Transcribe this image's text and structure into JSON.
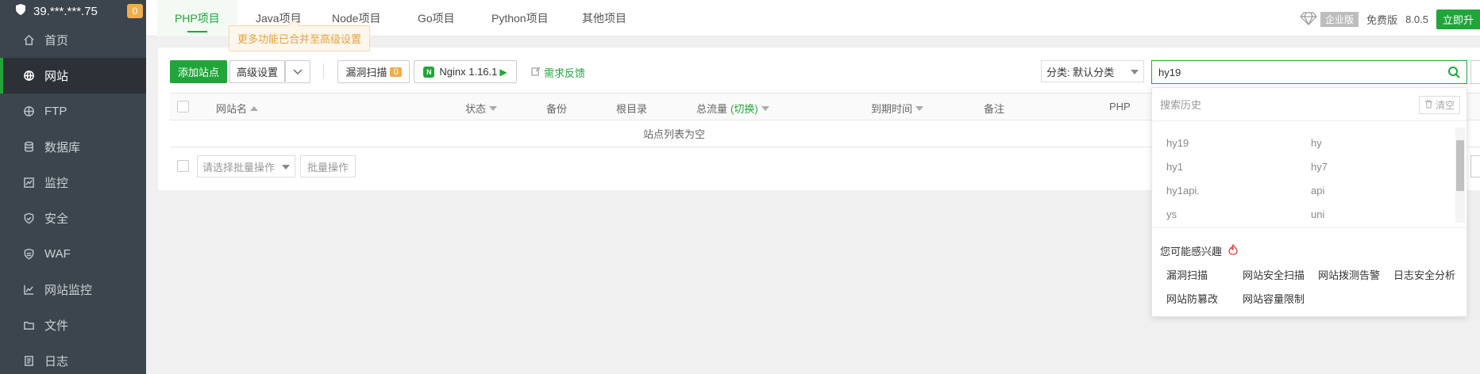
{
  "sidebar": {
    "server": "39.***.***.75",
    "badge": "0",
    "items": [
      {
        "label": "首页",
        "icon": "home-icon"
      },
      {
        "label": "网站",
        "icon": "globe-icon"
      },
      {
        "label": "FTP",
        "icon": "ftp-icon"
      },
      {
        "label": "数据库",
        "icon": "database-icon"
      },
      {
        "label": "监控",
        "icon": "monitor-icon"
      },
      {
        "label": "安全",
        "icon": "shield-icon"
      },
      {
        "label": "WAF",
        "icon": "waf-icon"
      },
      {
        "label": "网站监控",
        "icon": "chart-icon"
      },
      {
        "label": "文件",
        "icon": "folder-icon"
      },
      {
        "label": "日志",
        "icon": "log-icon"
      }
    ]
  },
  "tabs": [
    "PHP项目",
    "Java项目",
    "Node项目",
    "Go项目",
    "Python项目",
    "其他项目"
  ],
  "top_right": {
    "enterprise": "企业版",
    "free": "免费版",
    "version": "8.0.5",
    "buy": "立即升"
  },
  "tooltip": "更多功能已合并至高级设置",
  "toolbar": {
    "add_site": "添加站点",
    "advanced": "高级设置",
    "vuln_scan": "漏洞扫描",
    "vuln_count": "0",
    "nginx": "Nginx 1.16.1",
    "feedback": "需求反馈",
    "category": "分类: 默认分类"
  },
  "table": {
    "headers": {
      "name": "网站名",
      "status": "状态",
      "backup": "备份",
      "root": "根目录",
      "traffic": "总流量",
      "switch": "(切换)",
      "expire": "到期时间",
      "note": "备注",
      "php": "PHP"
    },
    "empty": "站点列表为空",
    "batch_placeholder": "请选择批量操作",
    "batch_button": "批量操作"
  },
  "search": {
    "value": "hy19",
    "history_title": "搜索历史",
    "clear": "清空",
    "history": [
      "hy19",
      "hy",
      "hy1",
      "hy7",
      "hy1api.",
      "api",
      "ys",
      "uni"
    ],
    "interest_title": "您可能感兴趣",
    "recommendations": [
      "漏洞扫描",
      "网站安全扫描",
      "网站拨测告警",
      "日志安全分析",
      "网站防篡改",
      "网站容量限制"
    ]
  },
  "colors": {
    "accent": "#20a53a",
    "sidebar_bg": "#3c444d",
    "warning": "#f0ad4e"
  }
}
